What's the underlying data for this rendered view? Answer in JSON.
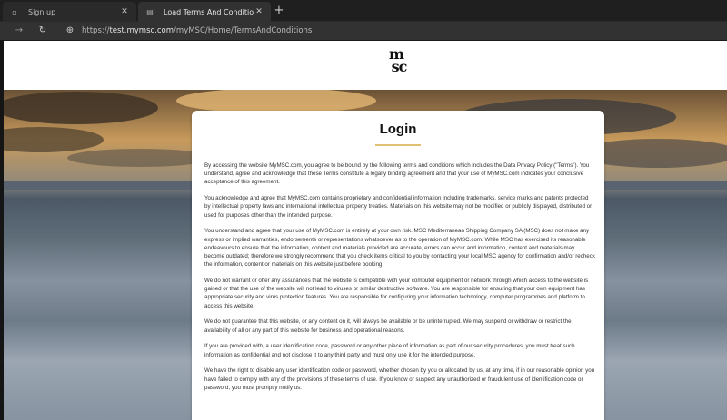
{
  "browser": {
    "tabs": [
      {
        "title": "Sign up",
        "active": false
      },
      {
        "title": "Load Terms And Conditions",
        "active": true
      }
    ],
    "new_tab": "+",
    "url_scheme": "https://",
    "url_host": "test.mymsc.com",
    "url_path": "/myMSC/Home/TermsAndConditions"
  },
  "header": {
    "logo_top": "m",
    "logo_bottom": "sc"
  },
  "card": {
    "title": "Login",
    "paragraphs": [
      "By accessing the website MyMSC.com, you agree to be bound by the following terms and conditions which includes the Data Privacy Policy (\"Terms\"). You understand, agree and acknowledge that these Terms constitute a legally binding agreement and that your use of MyMSC.com indicates your conclusive acceptance of this agreement.",
      "You acknowledge and agree that MyMSC.com contains proprietary and confidential information including trademarks, service marks and patents protected by intellectual property laws and international intellectual property treaties. Materials on this website may not be modified or publicly displayed, distributed or used for purposes other than the intended purpose.",
      "You understand and agree that your use of MyMSC.com is entirely at your own risk. MSC Mediterranean Shipping Company SA (MSC) does not make any express or implied warranties, endorsements or representations whatsoever as to the operation of MyMSC.com. While MSC has exercised its reasonable endeavours to ensure that the information, content and materials provided are accurate, errors can occur and information, content and materials may become outdated; therefore we strongly recommend that you check items critical to you by contacting your local MSC agency for confirmation and/or recheck the information, content or materials on this website just before booking.",
      "We do not warrant or offer any assurances that the website is compatible with your computer equipment or network through which access to the website is gained or that the use of the website will not lead to viruses or similar destructive software. You are responsible for ensuring that your own equipment has appropriate security and virus protection features. You are responsible for configuring your information technology, computer programmes and platform to access this website.",
      "We do not guarantee that this website, or any content on it, will always be available or be uninterrupted. We may suspend or withdraw or restrict the availability of all or any part of this website for business and operational reasons.",
      "If you are provided with, a user identification code, password or any other piece of information as part of our security procedures, you must treat such information as confidential and not disclose it to any third party and must only use it for the intended purpose.",
      "We have the right to disable any user identification code or password, whether chosen by you or allocated by us, at any time, if in our reasonable opinion you have failed to comply with any of the provisions of these terms of use. If you know or suspect any unauthorized or fraudulent use of identification code or password, you must promptly notify us."
    ]
  }
}
